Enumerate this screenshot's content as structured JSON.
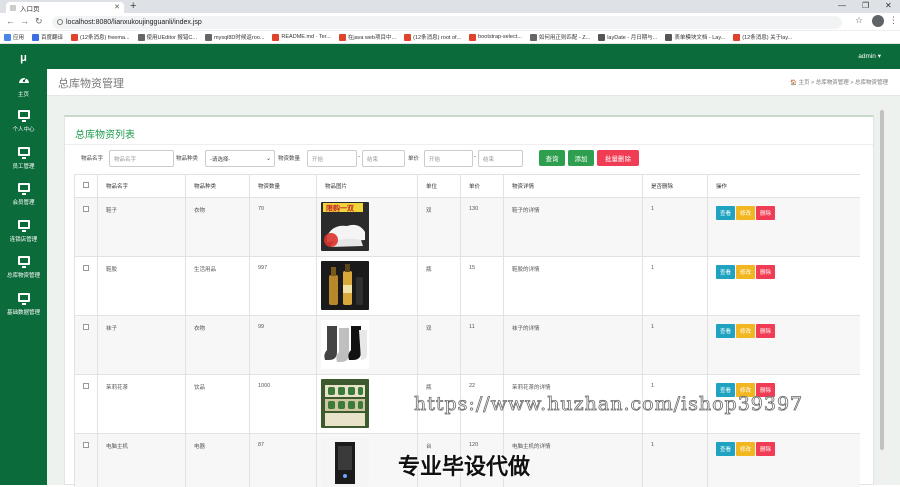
{
  "browser": {
    "tab_title": "入口页",
    "url": "localhost:8080/lianxukoujingguanli/index.jsp",
    "bookmarks": [
      {
        "label": "应用",
        "color": "#4a86e8"
      },
      {
        "label": "百度翻译",
        "color": "#3b6fe0"
      },
      {
        "label": "(12条消息) freema...",
        "color": "#e0422b"
      },
      {
        "label": "使用UEditor 报错C...",
        "color": "#666666"
      },
      {
        "label": "mysql8D时候返roo...",
        "color": "#666666"
      },
      {
        "label": "README.md · Ter...",
        "color": "#e0422b"
      },
      {
        "label": "在java web项目中...",
        "color": "#e0422b"
      },
      {
        "label": "(12条消息) root of...",
        "color": "#e0422b"
      },
      {
        "label": "bootstrap-select...",
        "color": "#e0422b"
      },
      {
        "label": "如何用正则匹配 - Z...",
        "color": "#666666"
      },
      {
        "label": "layDate - 月日期与...",
        "color": "#555555"
      },
      {
        "label": "表单模块文档 - Lay...",
        "color": "#555555"
      },
      {
        "label": "(12条消息) 关于lay...",
        "color": "#e0422b"
      }
    ]
  },
  "app": {
    "logo": "μ",
    "user": "admin ▾",
    "sidebar": [
      {
        "label": "主页"
      },
      {
        "label": "个人中心"
      },
      {
        "label": "员工管理"
      },
      {
        "label": "会员管理"
      },
      {
        "label": "连锁店管理"
      },
      {
        "label": "总库物资管理"
      },
      {
        "label": "基础数据管理"
      }
    ],
    "page_title": "总库物资管理",
    "breadcrumb": "🏠 主页  >  总库物资管理  >  总库物资管理"
  },
  "panel": {
    "title": "总库物资列表",
    "filters": {
      "name_label": "物品名字",
      "name_placeholder": "物品名字",
      "type_label": "物品种类",
      "type_value": "-请选择-",
      "qty_label": "物资数量",
      "qty_start": "开始",
      "qty_sep": "-",
      "qty_end": "结束",
      "price_label": "单价",
      "price_start": "开始",
      "price_sep": "-",
      "price_end": "结束",
      "btn_search": "查询",
      "btn_add": "添加",
      "btn_batch_delete": "批量删除"
    },
    "columns": [
      "",
      "物品名字",
      "物品种类",
      "物资数量",
      "物品图片",
      "单位",
      "单价",
      "物资详情",
      "是否删除",
      "操作"
    ],
    "rows": [
      {
        "name": "鞋子",
        "type": "衣物",
        "qty": "70",
        "img": "shoes",
        "unit": "双",
        "price": "130",
        "detail": "鞋子的详情",
        "deleted": "1"
      },
      {
        "name": "鞋胶",
        "type": "生活用品",
        "qty": "997",
        "img": "bottles",
        "unit": "瓶",
        "price": "15",
        "detail": "鞋胶的详情",
        "deleted": "1"
      },
      {
        "name": "袜子",
        "type": "衣物",
        "qty": "99",
        "img": "socks",
        "unit": "双",
        "price": "11",
        "detail": "袜子的详情",
        "deleted": "1"
      },
      {
        "name": "茉莉花茶",
        "type": "饮品",
        "qty": "1000",
        "img": "tea",
        "unit": "瓶",
        "price": "22",
        "detail": "茉莉花茶的详情",
        "deleted": "1"
      },
      {
        "name": "电脑主机",
        "type": "电器",
        "qty": "87",
        "img": "pc",
        "unit": "台",
        "price": "120",
        "detail": "电脑主机的详情",
        "deleted": "1"
      }
    ],
    "ops": {
      "view": "查看",
      "edit": "修改",
      "delete": "删除"
    }
  },
  "watermark": {
    "url": "https://www.huzhan.com/ishop39397",
    "text": "专业毕设代做",
    "shoe_badge": "限购一双"
  }
}
